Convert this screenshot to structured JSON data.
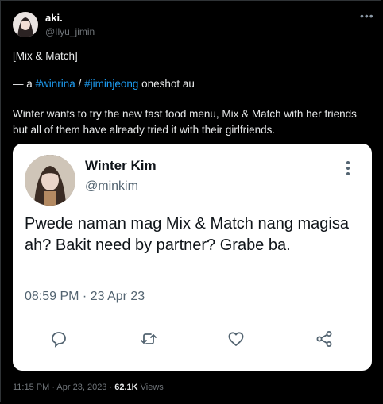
{
  "author": {
    "display_name": "aki.",
    "handle": "@Ilyu_jimin"
  },
  "tweet": {
    "line1": "[Mix & Match]",
    "line2_prefix": "— a ",
    "hashtag1": "#winrina",
    "separator": " / ",
    "hashtag2": "#jiminjeong",
    "line2_suffix": " oneshot au",
    "line3": "Winter wants to try the new fast food menu, Mix & Match with her friends but all of them have already tried it with their girlfriends."
  },
  "quoted": {
    "display_name": "Winter Kim",
    "handle": "@minkim",
    "text": "Pwede naman mag Mix & Match nang magisa ah? Bakit need by partner? Grabe ba.",
    "time": "08:59 PM · 23 Apr 23"
  },
  "footer": {
    "timestamp": "11:15 PM · Apr 23, 2023 · ",
    "views_count": "62.1K",
    "views_label": " Views"
  },
  "colors": {
    "background": "#000000",
    "link": "#1d9bf0",
    "card_background": "#ffffff",
    "muted": "#71767b"
  },
  "icons": [
    "more-icon",
    "vertical-more-icon",
    "reply-icon",
    "retweet-icon",
    "like-icon",
    "share-icon"
  ]
}
